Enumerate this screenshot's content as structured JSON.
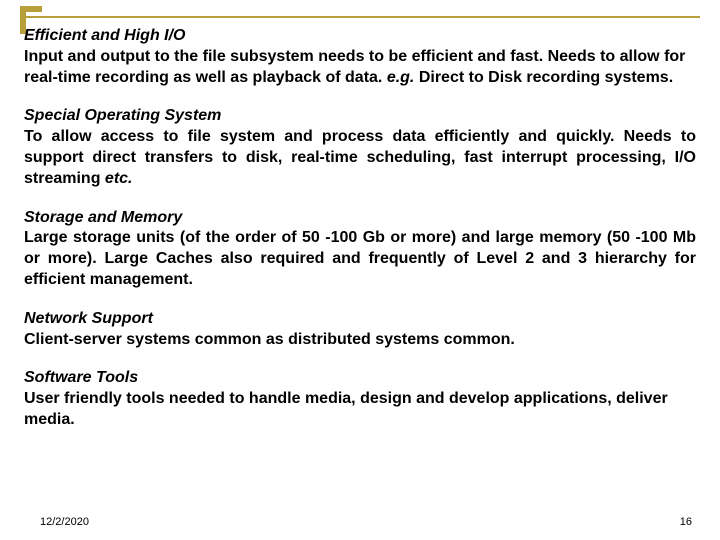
{
  "sections": [
    {
      "heading": "Efficient and High I/O",
      "body_pre": "Input and output to the file subsystem needs to be efficient and fast. Needs to allow for real-time recording as well as playback of data. ",
      "eg": "e.g.",
      "body_post": " Direct to Disk recording systems.",
      "justify": false
    },
    {
      "heading": "Special Operating System",
      "body_pre": "To allow access to file system and process data efficiently and quickly. Needs to support direct transfers to disk, real-time scheduling, fast interrupt processing, I/O streaming ",
      "eg": "etc.",
      "body_post": "",
      "justify": true
    },
    {
      "heading": "Storage and Memory",
      "body_pre": "Large storage units (of the order of 50 -100 Gb or more) and large memory (50 -100 Mb or more). Large Caches also required and frequently of Level 2 and 3 hierarchy for efficient management.",
      "eg": "",
      "body_post": "",
      "justify": true
    },
    {
      "heading": "Network Support",
      "body_pre": "Client-server systems common as distributed systems common.",
      "eg": "",
      "body_post": "",
      "justify": false
    },
    {
      "heading": "Software Tools",
      "body_pre": "User friendly tools needed to handle media, design and develop applications, deliver media.",
      "eg": "",
      "body_post": "",
      "justify": false
    }
  ],
  "footer": {
    "date": "12/2/2020",
    "page": "16"
  }
}
